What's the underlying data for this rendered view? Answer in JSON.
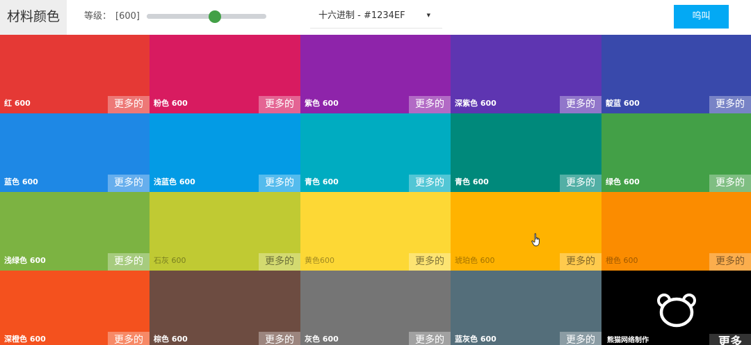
{
  "header": {
    "title": "材料颜色",
    "level_label": "等级：",
    "level_value": "[600]",
    "slider": {
      "value": 0.57
    },
    "format_select": {
      "value": "十六进制 - #1234EF",
      "caret": "▼"
    },
    "roar_button": "呜叫"
  },
  "more_label": "更多的",
  "tiles": [
    {
      "name": "红 600",
      "color": "#e53935",
      "text": "dark"
    },
    {
      "name": "粉色 600",
      "color": "#d81b60",
      "text": "dark"
    },
    {
      "name": "紫色 600",
      "color": "#8e24aa",
      "text": "dark"
    },
    {
      "name": "深紫色 600",
      "color": "#5e35b1",
      "text": "dark"
    },
    {
      "name": "靛蓝 600",
      "color": "#3949ab",
      "text": "dark"
    },
    {
      "name": "蓝色 600",
      "color": "#1e88e5",
      "text": "dark"
    },
    {
      "name": "浅蓝色 600",
      "color": "#039be5",
      "text": "dark"
    },
    {
      "name": "青色 600",
      "color": "#00acc1",
      "text": "dark"
    },
    {
      "name": "青色 600",
      "color": "#00897b",
      "text": "dark"
    },
    {
      "name": "绿色 600",
      "color": "#43a047",
      "text": "dark"
    },
    {
      "name": "浅绿色 600",
      "color": "#7cb342",
      "text": "dark"
    },
    {
      "name": "石灰 600",
      "color": "#c0ca33",
      "text": "light"
    },
    {
      "name": "黄色600",
      "color": "#fdd835",
      "text": "light"
    },
    {
      "name": "琥珀色 600",
      "color": "#ffb300",
      "text": "light"
    },
    {
      "name": "橙色 600",
      "color": "#fb8c00",
      "text": "light"
    },
    {
      "name": "深橙色 600",
      "color": "#f4511e",
      "text": "dark"
    },
    {
      "name": "棕色 600",
      "color": "#6d4c41",
      "text": "dark"
    },
    {
      "name": "灰色 600",
      "color": "#757575",
      "text": "dark"
    },
    {
      "name": "蓝灰色 600",
      "color": "#546e7a",
      "text": "dark"
    }
  ],
  "brand": {
    "name": "熊猫网络制作",
    "more_label": "更多",
    "icon": "bear-head-icon",
    "color": "#000000"
  },
  "cursor": {
    "icon": "hand-pointer-icon"
  }
}
